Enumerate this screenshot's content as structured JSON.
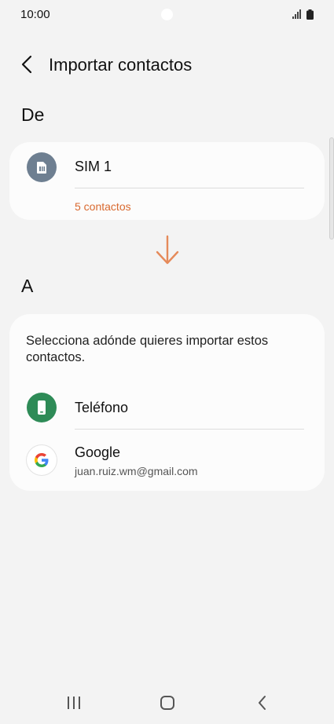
{
  "status_bar": {
    "time": "10:00",
    "icons": [
      "signal-icon",
      "battery-icon"
    ]
  },
  "header": {
    "title": "Importar contactos",
    "back_icon": "chevron-left-icon"
  },
  "from_section": {
    "heading": "De",
    "source": {
      "label": "SIM 1",
      "count": "5 contactos",
      "icon": "sim-card-icon"
    }
  },
  "arrow_icon": "arrow-down-icon",
  "to_section": {
    "heading": "A",
    "instruction": "Selecciona adónde quieres importar estos contactos.",
    "destinations": [
      {
        "label": "Teléfono",
        "icon": "phone-icon"
      },
      {
        "label": "Google",
        "account": "juan.ruiz.wm@gmail.com",
        "icon": "google-icon"
      }
    ]
  },
  "nav_bar": {
    "icons": [
      "recents-icon",
      "home-icon",
      "back-icon"
    ]
  },
  "colors": {
    "accent": "#d9692f",
    "background": "#f3f3f3",
    "card": "#fcfcfc",
    "sim_avatar": "#6e7f91",
    "phone_avatar": "#2e8b57"
  }
}
